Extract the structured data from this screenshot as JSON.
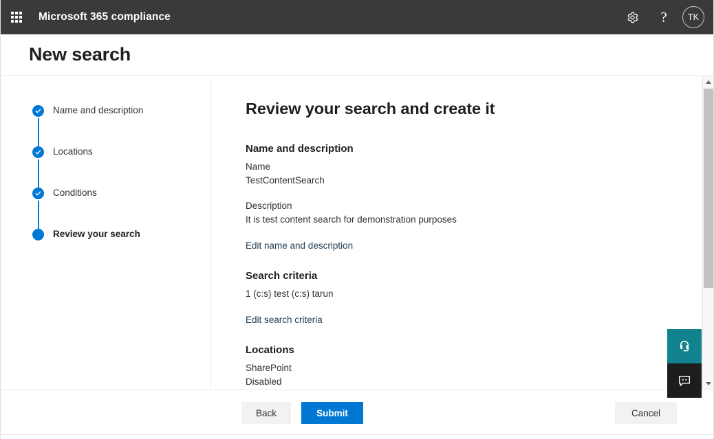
{
  "suite": {
    "waffle_icon": "waffle-grid-icon",
    "title": "Microsoft 365 compliance",
    "settings_icon": "gear-icon",
    "help_icon": "question-mark-icon",
    "avatar_initials": "TK"
  },
  "page": {
    "title": "New search"
  },
  "wizard": {
    "steps": [
      {
        "label": "Name and description",
        "state": "complete"
      },
      {
        "label": "Locations",
        "state": "complete"
      },
      {
        "label": "Conditions",
        "state": "complete"
      },
      {
        "label": "Review your search",
        "state": "current"
      }
    ]
  },
  "review": {
    "heading": "Review your search and create it",
    "name_section": {
      "heading": "Name and description",
      "name_label": "Name",
      "name_value": "TestContentSearch",
      "description_label": "Description",
      "description_value": "It is test content search for demonstration purposes",
      "edit_link": "Edit name and description"
    },
    "criteria_section": {
      "heading": "Search criteria",
      "value": "1 (c:s) test (c:s) tarun",
      "edit_link": "Edit search criteria"
    },
    "locations_section": {
      "heading": "Locations",
      "sharepoint_label": "SharePoint",
      "sharepoint_value": "Disabled"
    }
  },
  "scrollbar": {
    "up_icon": "chevron-up-icon",
    "down_icon": "chevron-down-icon"
  },
  "float_widgets": {
    "support_icon": "headset-support-icon",
    "chat_icon": "chat-bubble-icon"
  },
  "actions": {
    "back_label": "Back",
    "submit_label": "Submit",
    "cancel_label": "Cancel"
  },
  "colors": {
    "suite_bar": "#3b3a39",
    "accent": "#0078d4",
    "support_widget": "#11828e",
    "chat_widget": "#1d1d1d",
    "link": "#1f3c54"
  }
}
